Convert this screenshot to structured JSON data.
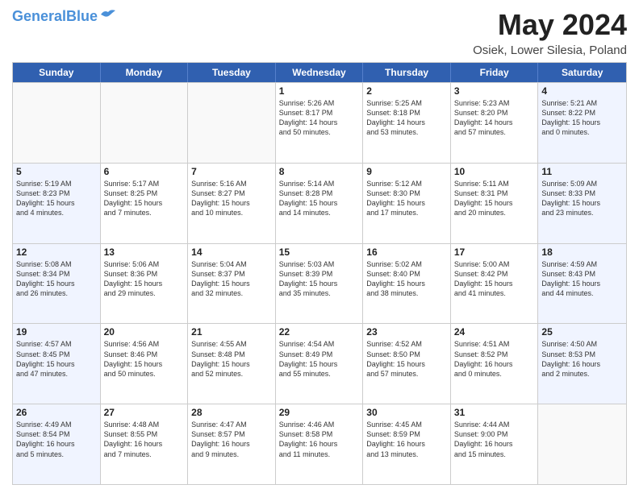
{
  "header": {
    "logo_general": "General",
    "logo_blue": "Blue",
    "month": "May 2024",
    "location": "Osiek, Lower Silesia, Poland"
  },
  "weekdays": [
    "Sunday",
    "Monday",
    "Tuesday",
    "Wednesday",
    "Thursday",
    "Friday",
    "Saturday"
  ],
  "rows": [
    [
      {
        "day": "",
        "lines": [],
        "type": "empty"
      },
      {
        "day": "",
        "lines": [],
        "type": "empty"
      },
      {
        "day": "",
        "lines": [],
        "type": "empty"
      },
      {
        "day": "1",
        "lines": [
          "Sunrise: 5:26 AM",
          "Sunset: 8:17 PM",
          "Daylight: 14 hours",
          "and 50 minutes."
        ],
        "type": "normal"
      },
      {
        "day": "2",
        "lines": [
          "Sunrise: 5:25 AM",
          "Sunset: 8:18 PM",
          "Daylight: 14 hours",
          "and 53 minutes."
        ],
        "type": "normal"
      },
      {
        "day": "3",
        "lines": [
          "Sunrise: 5:23 AM",
          "Sunset: 8:20 PM",
          "Daylight: 14 hours",
          "and 57 minutes."
        ],
        "type": "normal"
      },
      {
        "day": "4",
        "lines": [
          "Sunrise: 5:21 AM",
          "Sunset: 8:22 PM",
          "Daylight: 15 hours",
          "and 0 minutes."
        ],
        "type": "weekend"
      }
    ],
    [
      {
        "day": "5",
        "lines": [
          "Sunrise: 5:19 AM",
          "Sunset: 8:23 PM",
          "Daylight: 15 hours",
          "and 4 minutes."
        ],
        "type": "weekend"
      },
      {
        "day": "6",
        "lines": [
          "Sunrise: 5:17 AM",
          "Sunset: 8:25 PM",
          "Daylight: 15 hours",
          "and 7 minutes."
        ],
        "type": "normal"
      },
      {
        "day": "7",
        "lines": [
          "Sunrise: 5:16 AM",
          "Sunset: 8:27 PM",
          "Daylight: 15 hours",
          "and 10 minutes."
        ],
        "type": "normal"
      },
      {
        "day": "8",
        "lines": [
          "Sunrise: 5:14 AM",
          "Sunset: 8:28 PM",
          "Daylight: 15 hours",
          "and 14 minutes."
        ],
        "type": "normal"
      },
      {
        "day": "9",
        "lines": [
          "Sunrise: 5:12 AM",
          "Sunset: 8:30 PM",
          "Daylight: 15 hours",
          "and 17 minutes."
        ],
        "type": "normal"
      },
      {
        "day": "10",
        "lines": [
          "Sunrise: 5:11 AM",
          "Sunset: 8:31 PM",
          "Daylight: 15 hours",
          "and 20 minutes."
        ],
        "type": "normal"
      },
      {
        "day": "11",
        "lines": [
          "Sunrise: 5:09 AM",
          "Sunset: 8:33 PM",
          "Daylight: 15 hours",
          "and 23 minutes."
        ],
        "type": "weekend"
      }
    ],
    [
      {
        "day": "12",
        "lines": [
          "Sunrise: 5:08 AM",
          "Sunset: 8:34 PM",
          "Daylight: 15 hours",
          "and 26 minutes."
        ],
        "type": "weekend"
      },
      {
        "day": "13",
        "lines": [
          "Sunrise: 5:06 AM",
          "Sunset: 8:36 PM",
          "Daylight: 15 hours",
          "and 29 minutes."
        ],
        "type": "normal"
      },
      {
        "day": "14",
        "lines": [
          "Sunrise: 5:04 AM",
          "Sunset: 8:37 PM",
          "Daylight: 15 hours",
          "and 32 minutes."
        ],
        "type": "normal"
      },
      {
        "day": "15",
        "lines": [
          "Sunrise: 5:03 AM",
          "Sunset: 8:39 PM",
          "Daylight: 15 hours",
          "and 35 minutes."
        ],
        "type": "normal"
      },
      {
        "day": "16",
        "lines": [
          "Sunrise: 5:02 AM",
          "Sunset: 8:40 PM",
          "Daylight: 15 hours",
          "and 38 minutes."
        ],
        "type": "normal"
      },
      {
        "day": "17",
        "lines": [
          "Sunrise: 5:00 AM",
          "Sunset: 8:42 PM",
          "Daylight: 15 hours",
          "and 41 minutes."
        ],
        "type": "normal"
      },
      {
        "day": "18",
        "lines": [
          "Sunrise: 4:59 AM",
          "Sunset: 8:43 PM",
          "Daylight: 15 hours",
          "and 44 minutes."
        ],
        "type": "weekend"
      }
    ],
    [
      {
        "day": "19",
        "lines": [
          "Sunrise: 4:57 AM",
          "Sunset: 8:45 PM",
          "Daylight: 15 hours",
          "and 47 minutes."
        ],
        "type": "weekend"
      },
      {
        "day": "20",
        "lines": [
          "Sunrise: 4:56 AM",
          "Sunset: 8:46 PM",
          "Daylight: 15 hours",
          "and 50 minutes."
        ],
        "type": "normal"
      },
      {
        "day": "21",
        "lines": [
          "Sunrise: 4:55 AM",
          "Sunset: 8:48 PM",
          "Daylight: 15 hours",
          "and 52 minutes."
        ],
        "type": "normal"
      },
      {
        "day": "22",
        "lines": [
          "Sunrise: 4:54 AM",
          "Sunset: 8:49 PM",
          "Daylight: 15 hours",
          "and 55 minutes."
        ],
        "type": "normal"
      },
      {
        "day": "23",
        "lines": [
          "Sunrise: 4:52 AM",
          "Sunset: 8:50 PM",
          "Daylight: 15 hours",
          "and 57 minutes."
        ],
        "type": "normal"
      },
      {
        "day": "24",
        "lines": [
          "Sunrise: 4:51 AM",
          "Sunset: 8:52 PM",
          "Daylight: 16 hours",
          "and 0 minutes."
        ],
        "type": "normal"
      },
      {
        "day": "25",
        "lines": [
          "Sunrise: 4:50 AM",
          "Sunset: 8:53 PM",
          "Daylight: 16 hours",
          "and 2 minutes."
        ],
        "type": "weekend"
      }
    ],
    [
      {
        "day": "26",
        "lines": [
          "Sunrise: 4:49 AM",
          "Sunset: 8:54 PM",
          "Daylight: 16 hours",
          "and 5 minutes."
        ],
        "type": "weekend"
      },
      {
        "day": "27",
        "lines": [
          "Sunrise: 4:48 AM",
          "Sunset: 8:55 PM",
          "Daylight: 16 hours",
          "and 7 minutes."
        ],
        "type": "normal"
      },
      {
        "day": "28",
        "lines": [
          "Sunrise: 4:47 AM",
          "Sunset: 8:57 PM",
          "Daylight: 16 hours",
          "and 9 minutes."
        ],
        "type": "normal"
      },
      {
        "day": "29",
        "lines": [
          "Sunrise: 4:46 AM",
          "Sunset: 8:58 PM",
          "Daylight: 16 hours",
          "and 11 minutes."
        ],
        "type": "normal"
      },
      {
        "day": "30",
        "lines": [
          "Sunrise: 4:45 AM",
          "Sunset: 8:59 PM",
          "Daylight: 16 hours",
          "and 13 minutes."
        ],
        "type": "normal"
      },
      {
        "day": "31",
        "lines": [
          "Sunrise: 4:44 AM",
          "Sunset: 9:00 PM",
          "Daylight: 16 hours",
          "and 15 minutes."
        ],
        "type": "normal"
      },
      {
        "day": "",
        "lines": [],
        "type": "empty"
      }
    ]
  ]
}
